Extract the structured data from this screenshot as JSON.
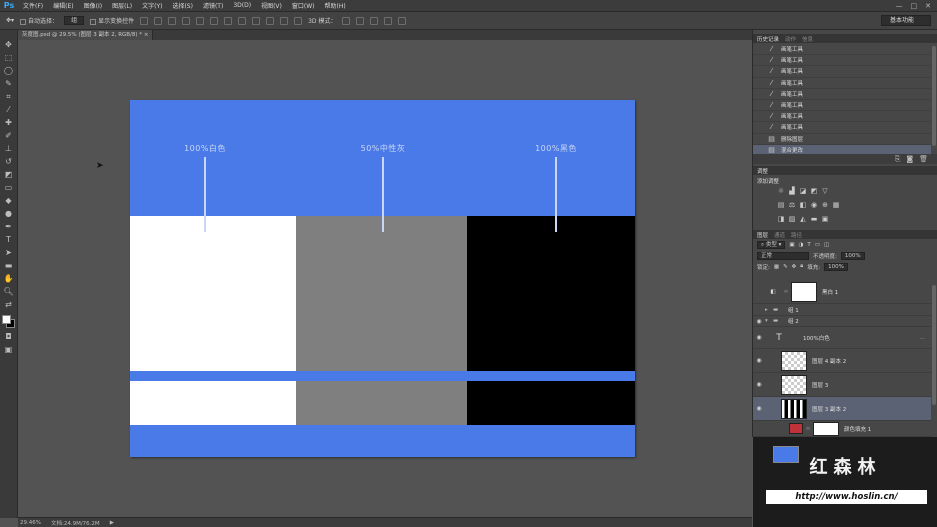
{
  "app": {
    "logo": "Ps"
  },
  "menu": [
    "文件(F)",
    "编辑(E)",
    "图像(I)",
    "图层(L)",
    "文字(Y)",
    "选择(S)",
    "滤镜(T)",
    "3D(D)",
    "视图(V)",
    "窗口(W)",
    "帮助(H)"
  ],
  "window_controls": [
    "—",
    "□",
    "✕"
  ],
  "options": {
    "auto_select_label": "自动选择：",
    "auto_select_value": "组",
    "show_transform_label": "显示变换控件",
    "mode_3d_label": "3D 模式：",
    "workspace": "基本功能"
  },
  "document": {
    "tab_title": "灰度图.psd @ 29.5% (图层 3 副本 2, RGB/8) *",
    "tab_close": "×",
    "labels": [
      "100%白色",
      "50%中性灰",
      "100%黑色"
    ],
    "colors": {
      "accent": "#4a7ae8",
      "white": "#ffffff",
      "gray": "#7f7f7f",
      "black": "#000000"
    }
  },
  "status": {
    "zoom": "29.46%",
    "doc_info": "文档:24.9M/76.2M",
    "arrow": "▶"
  },
  "history": {
    "tabs": [
      "历史记录",
      "动作",
      "信息"
    ],
    "items": [
      {
        "label": "画笔工具",
        "icon": "brush-icon"
      },
      {
        "label": "画笔工具",
        "icon": "brush-icon"
      },
      {
        "label": "画笔工具",
        "icon": "brush-icon"
      },
      {
        "label": "画笔工具",
        "icon": "brush-icon"
      },
      {
        "label": "画笔工具",
        "icon": "brush-icon"
      },
      {
        "label": "画笔工具",
        "icon": "brush-icon"
      },
      {
        "label": "画笔工具",
        "icon": "brush-icon"
      },
      {
        "label": "画笔工具",
        "icon": "brush-icon"
      },
      {
        "label": "删除图层",
        "icon": "layer-icon"
      },
      {
        "label": "混合更改",
        "icon": "layer-icon"
      }
    ],
    "active_index": 9
  },
  "adjustments": {
    "tab": "调整",
    "title": "添加调整"
  },
  "layers": {
    "tabs": [
      "图层",
      "通道",
      "路径"
    ],
    "kind_label": "类型",
    "blend_mode": "正常",
    "opacity_label": "不透明度:",
    "opacity_value": "100%",
    "lock_label": "锁定:",
    "fill_label": "填充:",
    "fill_value": "100%",
    "items": [
      {
        "name": "黑白 1",
        "type": "adjustment"
      },
      {
        "name": "组 1",
        "type": "group"
      },
      {
        "name": "组 2",
        "type": "group-open"
      },
      {
        "name": "100%白色",
        "type": "text"
      },
      {
        "name": "图层 4 副本 2",
        "type": "pixel"
      },
      {
        "name": "图层 3",
        "type": "pixel"
      },
      {
        "name": "图层 3 副本 2",
        "type": "pixel-active"
      },
      {
        "name": "颜色填充 1",
        "type": "fill"
      }
    ],
    "active_index": 6
  },
  "watermark": {
    "title": "红森林",
    "url": "http://www.hoslin.cn/"
  }
}
